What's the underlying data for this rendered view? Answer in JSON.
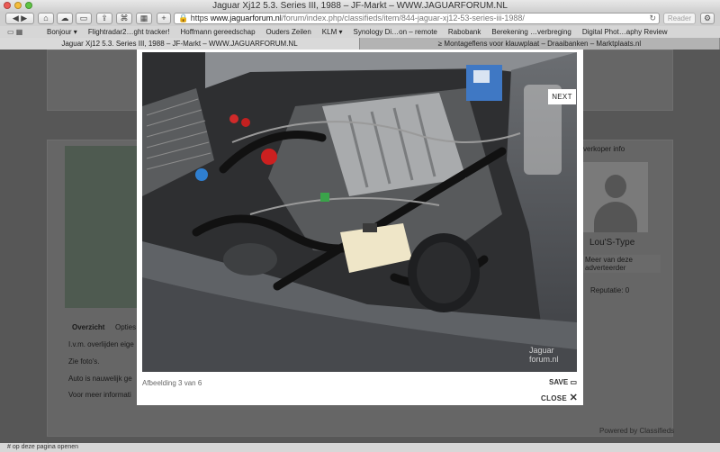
{
  "window": {
    "title": "Jaguar Xj12 5.3. Series III, 1988 – JF-Markt – WWW.JAGUARFORUM.NL"
  },
  "toolbar": {
    "url_scheme": "https",
    "url_domain": "www.jaguarforum.nl",
    "url_path": "/forum/index.php/classifieds/item/844-jaguar-xj12-53-series-iii-1988/",
    "reader_label": "Reader",
    "add_label": "+"
  },
  "bookmarks": [
    "Bonjour ▾",
    "Flightradar2…ght tracker!",
    "Hoffmann gereedschap",
    "Ouders Zeilen",
    "KLM ▾",
    "Synology Di…on – remote",
    "Rabobank",
    "Berekening …verbreging",
    "Digital Phot…aphy Review"
  ],
  "tabs": [
    {
      "label": "Jaguar Xj12 5.3. Series III, 1988 – JF-Markt – WWW.JAGUARFORUM.NL",
      "active": true
    },
    {
      "label": "≥ Montageflens voor klauwplaat – Draaibanken – Marktplaats.nl",
      "active": false
    }
  ],
  "background_page": {
    "tab_overview": "Overzicht",
    "tab_options": "Opties",
    "line1": "I.v.m. overlijden eige",
    "line2": "Zie foto's.",
    "line3": "Auto is nauwelijk ge",
    "line4": "Voor meer informati",
    "seller_heading": "verkoper info",
    "seller_name": "Lou'S-Type",
    "seller_more": "Meer van deze adverteerder",
    "reputation": "Reputatie: 0",
    "powered_by": "Powered by Classifieds"
  },
  "lightbox": {
    "counter": "Afbeelding 3 van 6",
    "save_label": "SAVE",
    "close_label": "CLOSE",
    "next_label": "NEXT",
    "watermark": "Jaguar forum.nl"
  },
  "status": {
    "text": "# op deze pagina openen"
  }
}
